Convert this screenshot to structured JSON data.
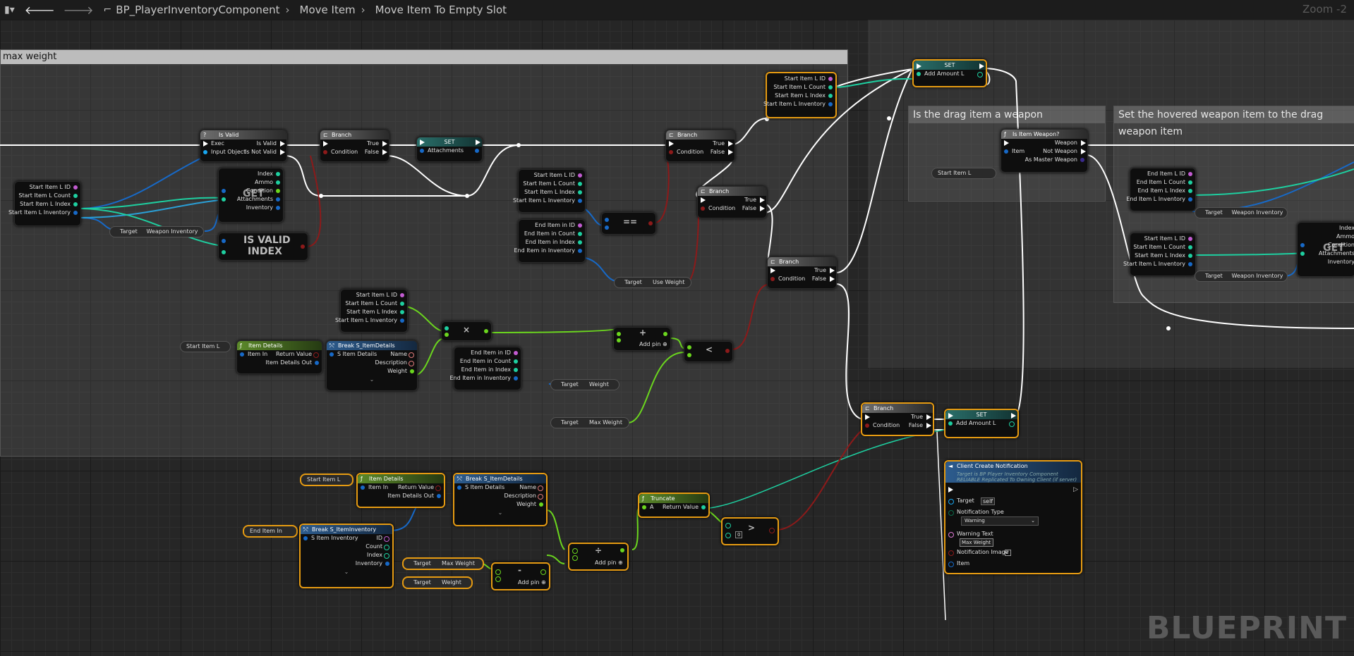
{
  "toolbar": {
    "blueprint_name": "BP_PlayerInventoryComponent",
    "crumb1": "Move Item",
    "crumb2": "Move Item To Empty Slot",
    "zoom": "Zoom -2"
  },
  "comments": {
    "max_weight": "max weight",
    "is_weapon": "Is the drag item a weapon",
    "set_hovered": "Set the hovered weapon item to the drag weapon item"
  },
  "watermark": "BLUEPRINT",
  "nodes": {
    "start_item_vars": [
      "Start Item L ID",
      "Start Item L Count",
      "Start Item L Index",
      "Start Item L Inventory"
    ],
    "is_valid": {
      "title": "Is Valid",
      "exec": "Exec",
      "input": "Input Object",
      "out1": "Is Valid",
      "out2": "Is Not Valid"
    },
    "branch": {
      "title": "Branch",
      "cond": "Condition",
      "t": "True",
      "f": "False"
    },
    "set": {
      "title": "SET",
      "attachments": "Attachments",
      "add_amount": "Add Amount L"
    },
    "get_pins": [
      "Index",
      "Ammo",
      "Condition",
      "Attachments",
      "Inventory"
    ],
    "get_label": "GET",
    "is_valid_index": [
      "IS VALID",
      "INDEX"
    ],
    "target": "Target",
    "weapon_inventory": "Weapon Inventory",
    "end_item_vars": [
      "End Item in ID",
      "End Item in Count",
      "End Item in Index",
      "End Item in Inventory"
    ],
    "end_item_l_vars": [
      "End Item L ID",
      "End Item L Count",
      "End Item L Index",
      "End Item L Inventory"
    ],
    "equals": "==",
    "use_weight": "Use Weight",
    "multiply": "×",
    "add": "+",
    "add_pin": "Add pin",
    "less": "<",
    "greater": ">",
    "divide": "÷",
    "minus": "-",
    "start_item_l": "Start Item L",
    "end_item_in": "End Item In",
    "item_details": {
      "title": "Item Details",
      "in": "Item In",
      "rv": "Return Value",
      "out": "Item Details Out"
    },
    "break_details": {
      "title": "Break S_ItemDetails",
      "in": "S Item Details",
      "name": "Name",
      "desc": "Description",
      "weight": "Weight"
    },
    "break_inventory": {
      "title": "Break S_ItemInventory",
      "in": "S Item Inventory",
      "id": "ID",
      "count": "Count",
      "index": "Index",
      "inventory": "Inventory"
    },
    "weight": "Weight",
    "max_weight": "Max Weight",
    "truncate": {
      "title": "Truncate",
      "a": "A",
      "rv": "Return Value"
    },
    "const_zero": "0",
    "is_item_weapon": {
      "title": "Is Item Weapon?",
      "item": "Item",
      "weapon": "Weapon",
      "not_weapon": "Not Weapon",
      "master": "As Master Weapon"
    },
    "notification": {
      "title": "Client Create Notification",
      "sub1": "Target is BP Player Inventory Component",
      "sub2": "RELIABLE Replicated To Owning Client (if server)",
      "target": "Target",
      "self": "self",
      "type_label": "Notification Type",
      "type_value": "Warning",
      "warning_label": "Warning Text",
      "warning_value": "Max Weight",
      "image": "Notification Image",
      "item": "Item"
    }
  },
  "colors": {
    "exec": "#ffffff",
    "bool": "#8c1a1a",
    "int": "#1ecfa0",
    "float": "#6bd61e",
    "struct": "#1769c7",
    "name": "#c25bd1",
    "object": "#18a6f0",
    "selected": "#e69b12"
  }
}
